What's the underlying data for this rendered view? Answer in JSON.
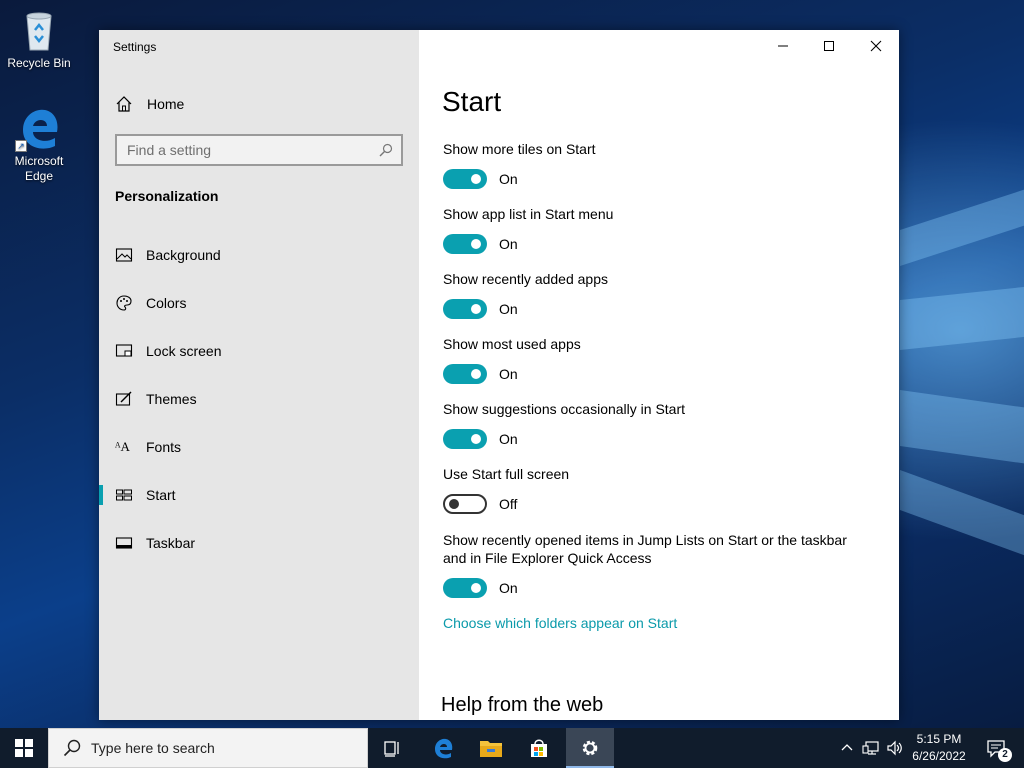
{
  "desktop": {
    "icons": [
      {
        "label": "Recycle Bin",
        "icon": "recycle-bin-icon"
      },
      {
        "label": "Microsoft Edge",
        "icon": "edge-icon"
      }
    ]
  },
  "window": {
    "title": "Settings",
    "controls": [
      "minimize-icon",
      "maximize-icon",
      "close-icon"
    ]
  },
  "nav": {
    "home_label": "Home",
    "search_placeholder": "Find a setting",
    "section_title": "Personalization",
    "items": [
      {
        "label": "Background",
        "icon": "background-icon"
      },
      {
        "label": "Colors",
        "icon": "palette-icon"
      },
      {
        "label": "Lock screen",
        "icon": "lock-screen-icon"
      },
      {
        "label": "Themes",
        "icon": "themes-icon"
      },
      {
        "label": "Fonts",
        "icon": "fonts-icon"
      },
      {
        "label": "Start",
        "icon": "start-icon",
        "selected": true
      },
      {
        "label": "Taskbar",
        "icon": "taskbar-icon"
      }
    ]
  },
  "content": {
    "title": "Start",
    "settings": [
      {
        "label": "Show more tiles on Start",
        "state": "On",
        "on": true
      },
      {
        "label": "Show app list in Start menu",
        "state": "On",
        "on": true
      },
      {
        "label": "Show recently added apps",
        "state": "On",
        "on": true
      },
      {
        "label": "Show most used apps",
        "state": "On",
        "on": true
      },
      {
        "label": "Show suggestions occasionally in Start",
        "state": "On",
        "on": true
      },
      {
        "label": "Use Start full screen",
        "state": "Off",
        "on": false
      },
      {
        "label": "Show recently opened items in Jump Lists on Start or the taskbar and in File Explorer Quick Access",
        "state": "On",
        "on": true
      }
    ],
    "link": "Choose which folders appear on Start",
    "help_title": "Help from the web"
  },
  "taskbar": {
    "search_placeholder": "Type here to search",
    "apps": [
      "task-view-icon",
      "edge-icon",
      "file-explorer-icon",
      "store-icon",
      "settings-gear-icon"
    ],
    "time": "5:15 PM",
    "date": "6/26/2022",
    "notification_count": "2"
  },
  "colors": {
    "accent": "#0aa0b0",
    "nav_bg": "#e6e6e6",
    "taskbar_bg": "#101c2c"
  }
}
